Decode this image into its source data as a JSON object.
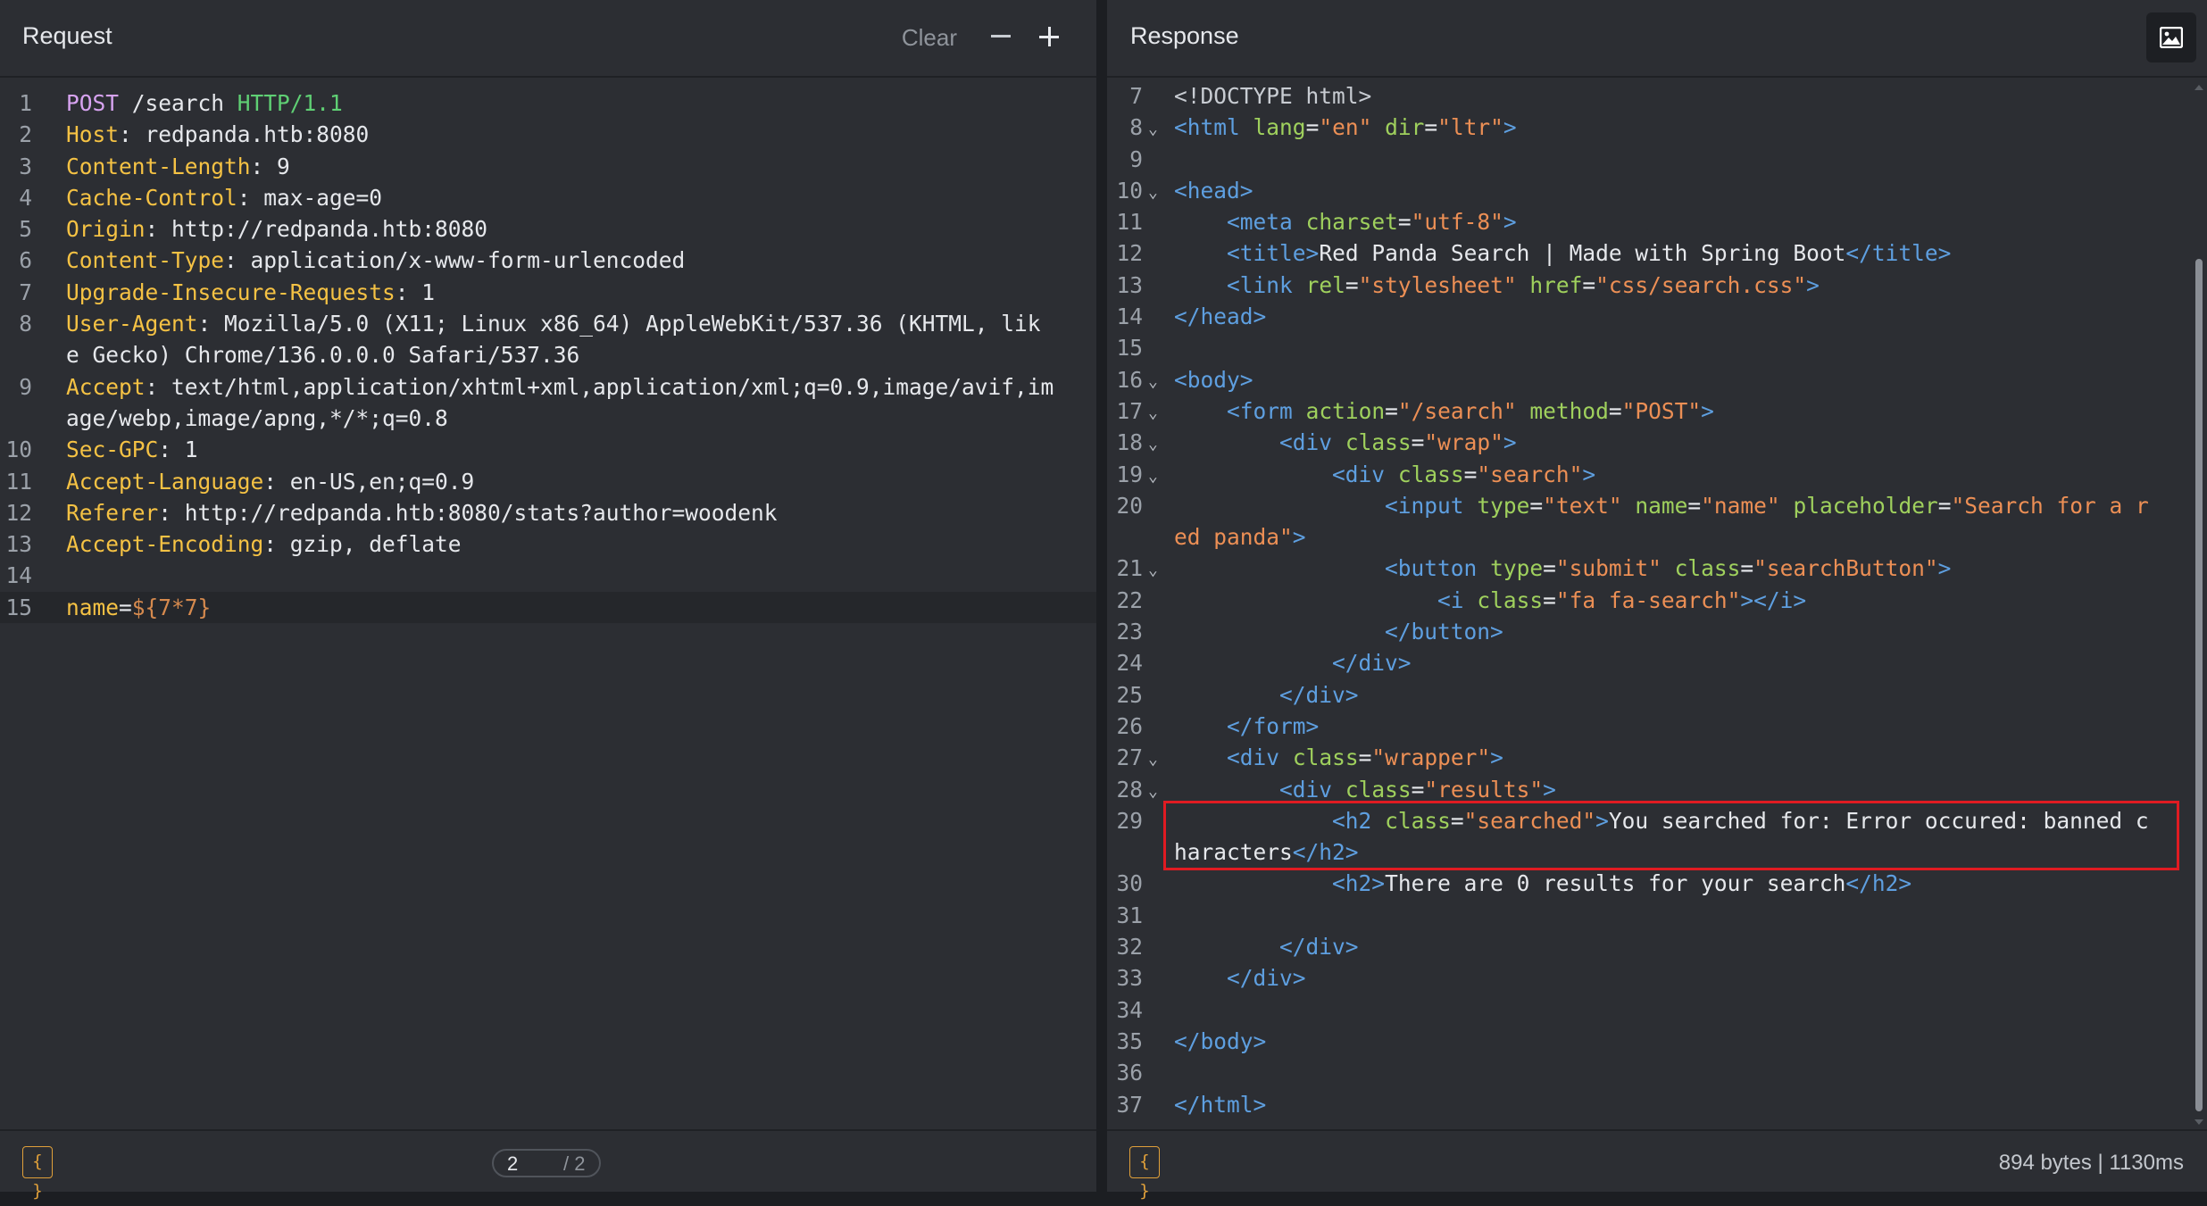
{
  "request": {
    "title": "Request",
    "clear_label": "Clear",
    "minus_label": "−",
    "plus_label": "+",
    "lines": [
      {
        "n": "1",
        "parts": [
          [
            "m",
            "POST"
          ],
          [
            "w",
            " /search "
          ],
          [
            "v",
            "HTTP/1.1"
          ]
        ]
      },
      {
        "n": "2",
        "parts": [
          [
            "k",
            "Host"
          ],
          [
            "w",
            ": redpanda.htb:8080"
          ]
        ]
      },
      {
        "n": "3",
        "parts": [
          [
            "k",
            "Content-Length"
          ],
          [
            "w",
            ": 9"
          ]
        ]
      },
      {
        "n": "4",
        "parts": [
          [
            "k",
            "Cache-Control"
          ],
          [
            "w",
            ": max-age=0"
          ]
        ]
      },
      {
        "n": "5",
        "parts": [
          [
            "k",
            "Origin"
          ],
          [
            "w",
            ": http://redpanda.htb:8080"
          ]
        ]
      },
      {
        "n": "6",
        "parts": [
          [
            "k",
            "Content-Type"
          ],
          [
            "w",
            ": application/x-www-form-urlencoded"
          ]
        ]
      },
      {
        "n": "7",
        "parts": [
          [
            "k",
            "Upgrade-Insecure-Requests"
          ],
          [
            "w",
            ": 1"
          ]
        ]
      },
      {
        "n": "8",
        "wrap": true,
        "parts": [
          [
            "k",
            "User-Agent"
          ],
          [
            "w",
            ": Mozilla/5.0 (X11; Linux x86_64) AppleWebKit/537.36 (KHTML, lik\ne Gecko) Chrome/136.0.0.0 Safari/537.36"
          ]
        ]
      },
      {
        "n": "9",
        "wrap": true,
        "parts": [
          [
            "k",
            "Accept"
          ],
          [
            "w",
            ": text/html,application/xhtml+xml,application/xml;q=0.9,image/avif,im\nage/webp,image/apng,*/*;q=0.8"
          ]
        ]
      },
      {
        "n": "10",
        "parts": [
          [
            "k",
            "Sec-GPC"
          ],
          [
            "w",
            ": 1"
          ]
        ]
      },
      {
        "n": "11",
        "parts": [
          [
            "k",
            "Accept-Language"
          ],
          [
            "w",
            ": en-US,en;q=0.9"
          ]
        ]
      },
      {
        "n": "12",
        "parts": [
          [
            "k",
            "Referer"
          ],
          [
            "w",
            ": http://redpanda.htb:8080/stats?author=woodenk"
          ]
        ]
      },
      {
        "n": "13",
        "parts": [
          [
            "k",
            "Accept-Encoding"
          ],
          [
            "w",
            ": gzip, deflate"
          ]
        ]
      },
      {
        "n": "14",
        "parts": []
      },
      {
        "n": "15",
        "active": true,
        "parts": [
          [
            "k",
            "name"
          ],
          [
            "w",
            "="
          ],
          [
            "p",
            "${7*7}"
          ]
        ]
      }
    ],
    "pager": {
      "current": "2",
      "total": "/ 2"
    }
  },
  "response": {
    "title": "Response",
    "image_icon": "image-icon",
    "lines": [
      {
        "n": "7",
        "parts": [
          [
            "g",
            "<!DOCTYPE html>"
          ]
        ]
      },
      {
        "n": "8",
        "fold": true,
        "parts": [
          [
            "b",
            "<"
          ],
          [
            "t",
            "html"
          ],
          [
            "w",
            " "
          ],
          [
            "a",
            "lang"
          ],
          [
            "w",
            "="
          ],
          [
            "s",
            "\"en\""
          ],
          [
            "w",
            " "
          ],
          [
            "a",
            "dir"
          ],
          [
            "w",
            "="
          ],
          [
            "s",
            "\"ltr\""
          ],
          [
            "b",
            ">"
          ]
        ]
      },
      {
        "n": "9",
        "parts": []
      },
      {
        "n": "10",
        "fold": true,
        "parts": [
          [
            "b",
            "<"
          ],
          [
            "t",
            "head"
          ],
          [
            "b",
            ">"
          ]
        ]
      },
      {
        "n": "11",
        "parts": [
          [
            "w",
            "    "
          ],
          [
            "b",
            "<"
          ],
          [
            "t",
            "meta"
          ],
          [
            "w",
            " "
          ],
          [
            "a",
            "charset"
          ],
          [
            "w",
            "="
          ],
          [
            "s",
            "\"utf-8\""
          ],
          [
            "b",
            ">"
          ]
        ]
      },
      {
        "n": "12",
        "parts": [
          [
            "w",
            "    "
          ],
          [
            "b",
            "<"
          ],
          [
            "t",
            "title"
          ],
          [
            "b",
            ">"
          ],
          [
            "w",
            "Red Panda Search | Made with Spring Boot"
          ],
          [
            "b",
            "</"
          ],
          [
            "t",
            "title"
          ],
          [
            "b",
            ">"
          ]
        ]
      },
      {
        "n": "13",
        "parts": [
          [
            "w",
            "    "
          ],
          [
            "b",
            "<"
          ],
          [
            "t",
            "link"
          ],
          [
            "w",
            " "
          ],
          [
            "a",
            "rel"
          ],
          [
            "w",
            "="
          ],
          [
            "s",
            "\"stylesheet\""
          ],
          [
            "w",
            " "
          ],
          [
            "a",
            "href"
          ],
          [
            "w",
            "="
          ],
          [
            "s",
            "\"css/search.css\""
          ],
          [
            "b",
            ">"
          ]
        ]
      },
      {
        "n": "14",
        "parts": [
          [
            "b",
            "</"
          ],
          [
            "t",
            "head"
          ],
          [
            "b",
            ">"
          ]
        ]
      },
      {
        "n": "15",
        "parts": []
      },
      {
        "n": "16",
        "fold": true,
        "parts": [
          [
            "b",
            "<"
          ],
          [
            "t",
            "body"
          ],
          [
            "b",
            ">"
          ]
        ]
      },
      {
        "n": "17",
        "fold": true,
        "parts": [
          [
            "w",
            "    "
          ],
          [
            "b",
            "<"
          ],
          [
            "t",
            "form"
          ],
          [
            "w",
            " "
          ],
          [
            "a",
            "action"
          ],
          [
            "w",
            "="
          ],
          [
            "s",
            "\"/search\""
          ],
          [
            "w",
            " "
          ],
          [
            "a",
            "method"
          ],
          [
            "w",
            "="
          ],
          [
            "s",
            "\"POST\""
          ],
          [
            "b",
            ">"
          ]
        ]
      },
      {
        "n": "18",
        "fold": true,
        "parts": [
          [
            "w",
            "        "
          ],
          [
            "b",
            "<"
          ],
          [
            "t",
            "div"
          ],
          [
            "w",
            " "
          ],
          [
            "a",
            "class"
          ],
          [
            "w",
            "="
          ],
          [
            "s",
            "\"wrap\""
          ],
          [
            "b",
            ">"
          ]
        ]
      },
      {
        "n": "19",
        "fold": true,
        "parts": [
          [
            "w",
            "            "
          ],
          [
            "b",
            "<"
          ],
          [
            "t",
            "div"
          ],
          [
            "w",
            " "
          ],
          [
            "a",
            "class"
          ],
          [
            "w",
            "="
          ],
          [
            "s",
            "\"search\""
          ],
          [
            "b",
            ">"
          ]
        ]
      },
      {
        "n": "20",
        "wrap": true,
        "parts": [
          [
            "w",
            "                "
          ],
          [
            "b",
            "<"
          ],
          [
            "t",
            "input"
          ],
          [
            "w",
            " "
          ],
          [
            "a",
            "type"
          ],
          [
            "w",
            "="
          ],
          [
            "s",
            "\"text\""
          ],
          [
            "w",
            " "
          ],
          [
            "a",
            "name"
          ],
          [
            "w",
            "="
          ],
          [
            "s",
            "\"name\""
          ],
          [
            "w",
            " "
          ],
          [
            "a",
            "placeholder"
          ],
          [
            "w",
            "="
          ],
          [
            "s",
            "\"Search for a r\ned panda\""
          ],
          [
            "b",
            ">"
          ]
        ]
      },
      {
        "n": "21",
        "fold": true,
        "parts": [
          [
            "w",
            "                "
          ],
          [
            "b",
            "<"
          ],
          [
            "t",
            "button"
          ],
          [
            "w",
            " "
          ],
          [
            "a",
            "type"
          ],
          [
            "w",
            "="
          ],
          [
            "s",
            "\"submit\""
          ],
          [
            "w",
            " "
          ],
          [
            "a",
            "class"
          ],
          [
            "w",
            "="
          ],
          [
            "s",
            "\"searchButton\""
          ],
          [
            "b",
            ">"
          ]
        ]
      },
      {
        "n": "22",
        "parts": [
          [
            "w",
            "                    "
          ],
          [
            "b",
            "<"
          ],
          [
            "t",
            "i"
          ],
          [
            "w",
            " "
          ],
          [
            "a",
            "class"
          ],
          [
            "w",
            "="
          ],
          [
            "s",
            "\"fa fa-search\""
          ],
          [
            "b",
            "></"
          ],
          [
            "t",
            "i"
          ],
          [
            "b",
            ">"
          ]
        ]
      },
      {
        "n": "23",
        "parts": [
          [
            "w",
            "                "
          ],
          [
            "b",
            "</"
          ],
          [
            "t",
            "button"
          ],
          [
            "b",
            ">"
          ]
        ]
      },
      {
        "n": "24",
        "parts": [
          [
            "w",
            "            "
          ],
          [
            "b",
            "</"
          ],
          [
            "t",
            "div"
          ],
          [
            "b",
            ">"
          ]
        ]
      },
      {
        "n": "25",
        "parts": [
          [
            "w",
            "        "
          ],
          [
            "b",
            "</"
          ],
          [
            "t",
            "div"
          ],
          [
            "b",
            ">"
          ]
        ]
      },
      {
        "n": "26",
        "parts": [
          [
            "w",
            "    "
          ],
          [
            "b",
            "</"
          ],
          [
            "t",
            "form"
          ],
          [
            "b",
            ">"
          ]
        ]
      },
      {
        "n": "27",
        "fold": true,
        "parts": [
          [
            "w",
            "    "
          ],
          [
            "b",
            "<"
          ],
          [
            "t",
            "div"
          ],
          [
            "w",
            " "
          ],
          [
            "a",
            "class"
          ],
          [
            "w",
            "="
          ],
          [
            "s",
            "\"wrapper\""
          ],
          [
            "b",
            ">"
          ]
        ]
      },
      {
        "n": "28",
        "fold": true,
        "parts": [
          [
            "w",
            "        "
          ],
          [
            "b",
            "<"
          ],
          [
            "t",
            "div"
          ],
          [
            "w",
            " "
          ],
          [
            "a",
            "class"
          ],
          [
            "w",
            "="
          ],
          [
            "s",
            "\"results\""
          ],
          [
            "b",
            ">"
          ]
        ]
      },
      {
        "n": "29",
        "wrap": true,
        "parts": [
          [
            "w",
            "            "
          ],
          [
            "b",
            "<"
          ],
          [
            "t",
            "h2"
          ],
          [
            "w",
            " "
          ],
          [
            "a",
            "class"
          ],
          [
            "w",
            "="
          ],
          [
            "s",
            "\"searched\""
          ],
          [
            "b",
            ">"
          ],
          [
            "w",
            "You searched for: Error occured: banned c\nharacters"
          ],
          [
            "b",
            "</"
          ],
          [
            "t",
            "h2"
          ],
          [
            "b",
            ">"
          ]
        ]
      },
      {
        "n": "30",
        "parts": [
          [
            "w",
            "            "
          ],
          [
            "b",
            "<"
          ],
          [
            "t",
            "h2"
          ],
          [
            "b",
            ">"
          ],
          [
            "w",
            "There are 0 results for your search"
          ],
          [
            "b",
            "</"
          ],
          [
            "t",
            "h2"
          ],
          [
            "b",
            ">"
          ]
        ]
      },
      {
        "n": "31",
        "parts": []
      },
      {
        "n": "32",
        "parts": [
          [
            "w",
            "        "
          ],
          [
            "b",
            "</"
          ],
          [
            "t",
            "div"
          ],
          [
            "b",
            ">"
          ]
        ]
      },
      {
        "n": "33",
        "parts": [
          [
            "w",
            "    "
          ],
          [
            "b",
            "</"
          ],
          [
            "t",
            "div"
          ],
          [
            "b",
            ">"
          ]
        ]
      },
      {
        "n": "34",
        "parts": []
      },
      {
        "n": "35",
        "parts": [
          [
            "b",
            "</"
          ],
          [
            "t",
            "body"
          ],
          [
            "b",
            ">"
          ]
        ]
      },
      {
        "n": "36",
        "parts": []
      },
      {
        "n": "37",
        "parts": [
          [
            "b",
            "</"
          ],
          [
            "t",
            "html"
          ],
          [
            "b",
            ">"
          ]
        ]
      }
    ],
    "fold_glyph": "⌄",
    "stats": "894 bytes  |  1130ms"
  },
  "footer": {
    "brace_label": "{ }"
  },
  "colors": {
    "header_key": "#f5c244",
    "method": "#d7a3f0",
    "version": "#5fcf74",
    "tag": "#5e9fe0",
    "attr": "#9fd05d",
    "string": "#ec8f55",
    "highlight": "#e01b22"
  }
}
